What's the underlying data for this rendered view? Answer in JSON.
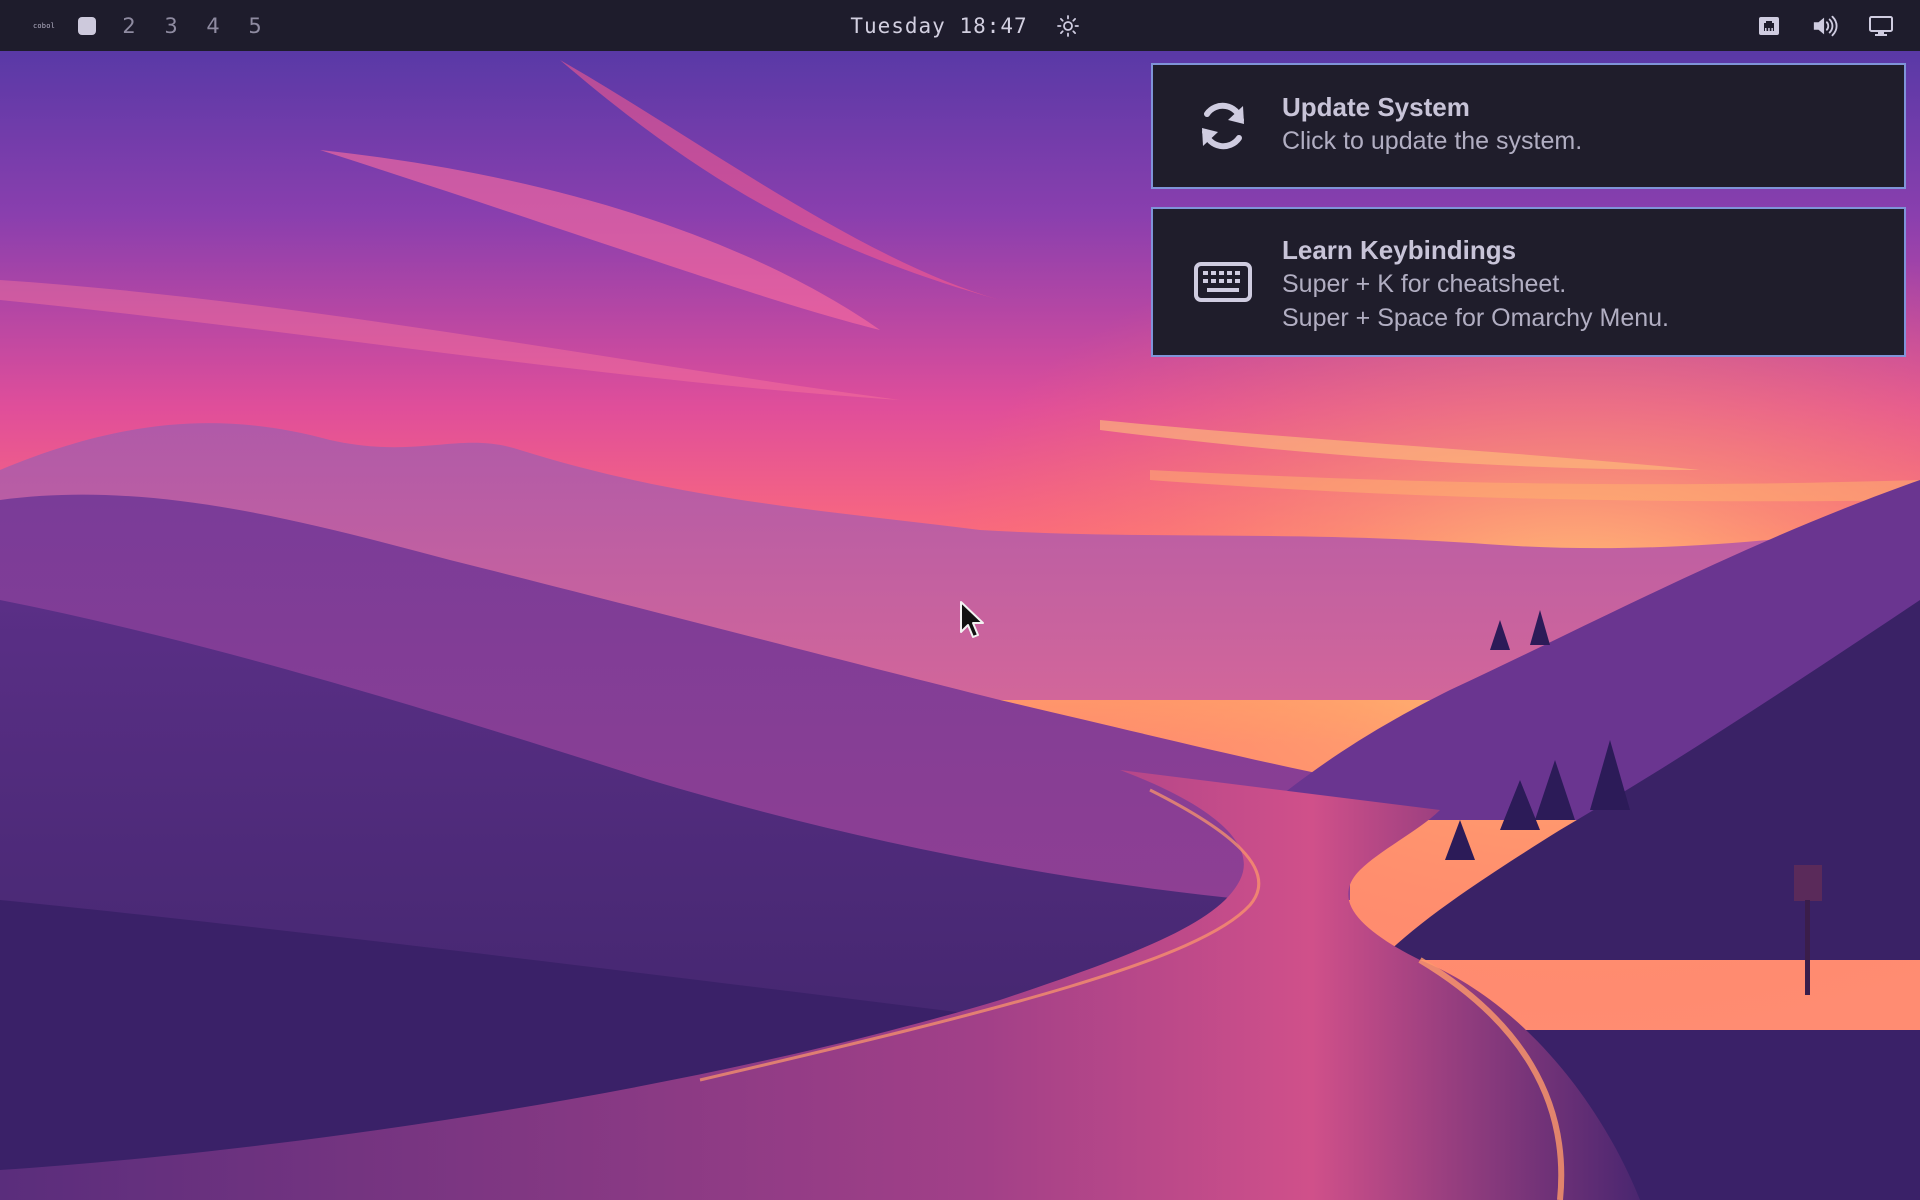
{
  "topbar": {
    "logo_text": "cobol",
    "workspaces": [
      "2",
      "3",
      "4",
      "5"
    ],
    "active_workspace_icon": "square-filled-icon",
    "clock": "Tuesday 18:47",
    "weather_icon": "sun-icon",
    "tray_icons": [
      "network-ethernet-icon",
      "volume-icon",
      "display-icon"
    ]
  },
  "notifications": [
    {
      "icon": "refresh-icon",
      "title": "Update System",
      "lines": [
        "Click to update the system."
      ]
    },
    {
      "icon": "keyboard-icon",
      "title": "Learn Keybindings",
      "lines": [
        "Super + K for cheatsheet.",
        "Super + Space for Omarchy Menu."
      ]
    }
  ],
  "colors": {
    "bar_bg": "#1e1c2c",
    "notification_bg": "#1f1d2b",
    "notification_border": "#7f94d8",
    "sky_top": "#5b3aa6",
    "sky_glow": "#ff7a5a"
  },
  "wallpaper": {
    "subject": "winding-road-through-purple-hills-at-sunset"
  }
}
